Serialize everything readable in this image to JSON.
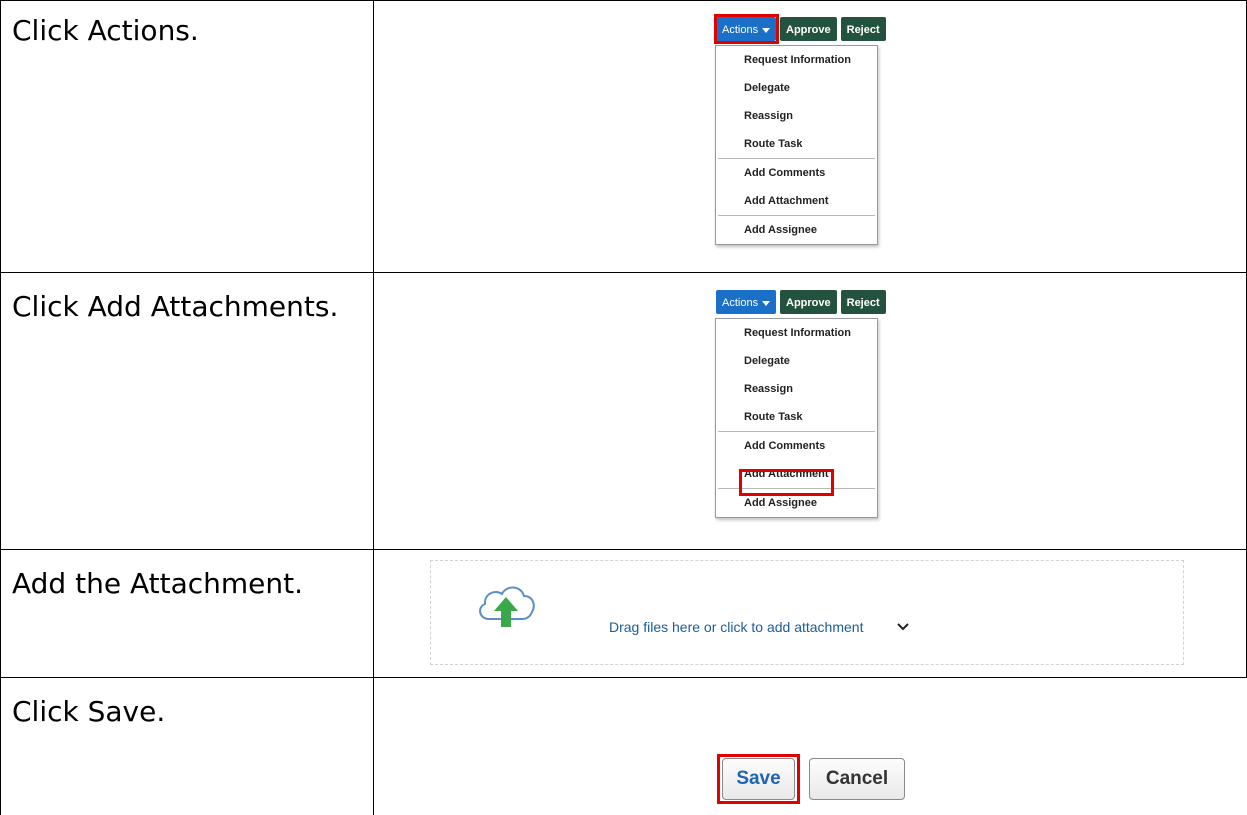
{
  "steps": [
    {
      "instruction": "Click Actions."
    },
    {
      "instruction": "Click Add Attachments."
    },
    {
      "instruction": "Add the Attachment."
    },
    {
      "instruction": "Click Save."
    }
  ],
  "toolbar": {
    "actions_label": "Actions",
    "approve_label": "Approve",
    "reject_label": "Reject"
  },
  "actions_menu": {
    "items": [
      "Request Information",
      "Delegate",
      "Reassign",
      "Route Task",
      "Add Comments",
      "Add Attachment",
      "Add Assignee"
    ]
  },
  "attachment": {
    "prompt": "Drag files here or click to add attachment"
  },
  "form_buttons": {
    "save_label": "Save",
    "cancel_label": "Cancel"
  },
  "colors": {
    "highlight": "#e00000",
    "actions_button": "#1a6fc8",
    "approve_reject_button": "#23533f",
    "link_text": "#1c5d99",
    "upload_arrow": "#3aa84a"
  }
}
